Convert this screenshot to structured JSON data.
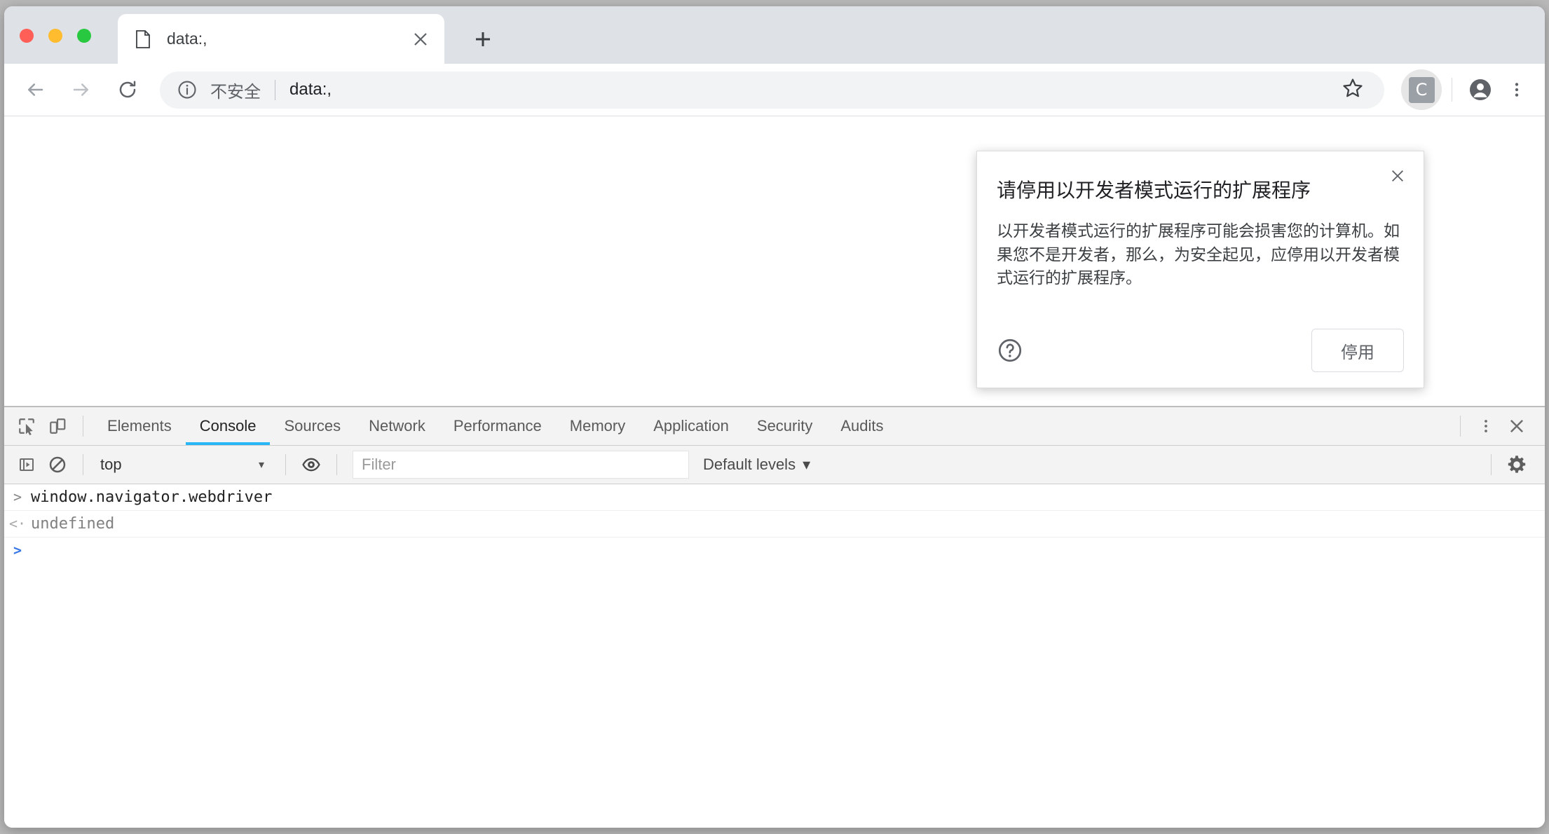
{
  "window": {
    "traffic_lights": [
      {
        "name": "close",
        "color": "#ff5f57"
      },
      {
        "name": "minimize",
        "color": "#febc2e"
      },
      {
        "name": "maximize",
        "color": "#28c840"
      }
    ]
  },
  "tabstrip": {
    "tabs": [
      {
        "title": "data:,",
        "favicon": "page-icon",
        "close_icon": "close-icon"
      }
    ],
    "new_tab_icon": "plus-icon"
  },
  "toolbar": {
    "back_icon": "arrow-left-icon",
    "forward_icon": "arrow-right-icon",
    "reload_icon": "reload-icon",
    "omnibox": {
      "info_icon": "info-circle-icon",
      "security_label": "不安全",
      "url": "data:,",
      "star_icon": "star-icon"
    },
    "extension_badge": "C",
    "profile_icon": "account-circle-icon",
    "menu_icon": "more-vertical-icon"
  },
  "bubble": {
    "title": "请停用以开发者模式运行的扩展程序",
    "body": "以开发者模式运行的扩展程序可能会损害您的计算机。如果您不是开发者，那么，为安全起见，应停用以开发者模式运行的扩展程序。",
    "close_icon": "close-icon",
    "help_icon": "help-circle-icon",
    "action_label": "停用"
  },
  "devtools": {
    "inspect_icon": "inspect-element-icon",
    "device_toolbar_icon": "device-toolbar-icon",
    "tabs": [
      {
        "label": "Elements",
        "active": false
      },
      {
        "label": "Console",
        "active": true
      },
      {
        "label": "Sources",
        "active": false
      },
      {
        "label": "Network",
        "active": false
      },
      {
        "label": "Performance",
        "active": false
      },
      {
        "label": "Memory",
        "active": false
      },
      {
        "label": "Application",
        "active": false
      },
      {
        "label": "Security",
        "active": false
      },
      {
        "label": "Audits",
        "active": false
      }
    ],
    "more_icon": "more-vertical-icon",
    "close_icon": "close-icon",
    "accent_color": "#29b6f6",
    "filterbar": {
      "sidebar_icon": "console-sidebar-icon",
      "clear_icon": "clear-console-icon",
      "context": "top",
      "context_caret": "▾",
      "eye_icon": "eye-icon",
      "filter_placeholder": "Filter",
      "levels_label": "Default levels",
      "levels_caret": "▾",
      "settings_icon": "gear-icon"
    },
    "console_lines": [
      {
        "type": "input",
        "gutter": ">",
        "text": "window.navigator.webdriver"
      },
      {
        "type": "output",
        "gutter": "<·",
        "text": "undefined"
      },
      {
        "type": "prompt",
        "gutter": ">",
        "text": ""
      }
    ]
  }
}
